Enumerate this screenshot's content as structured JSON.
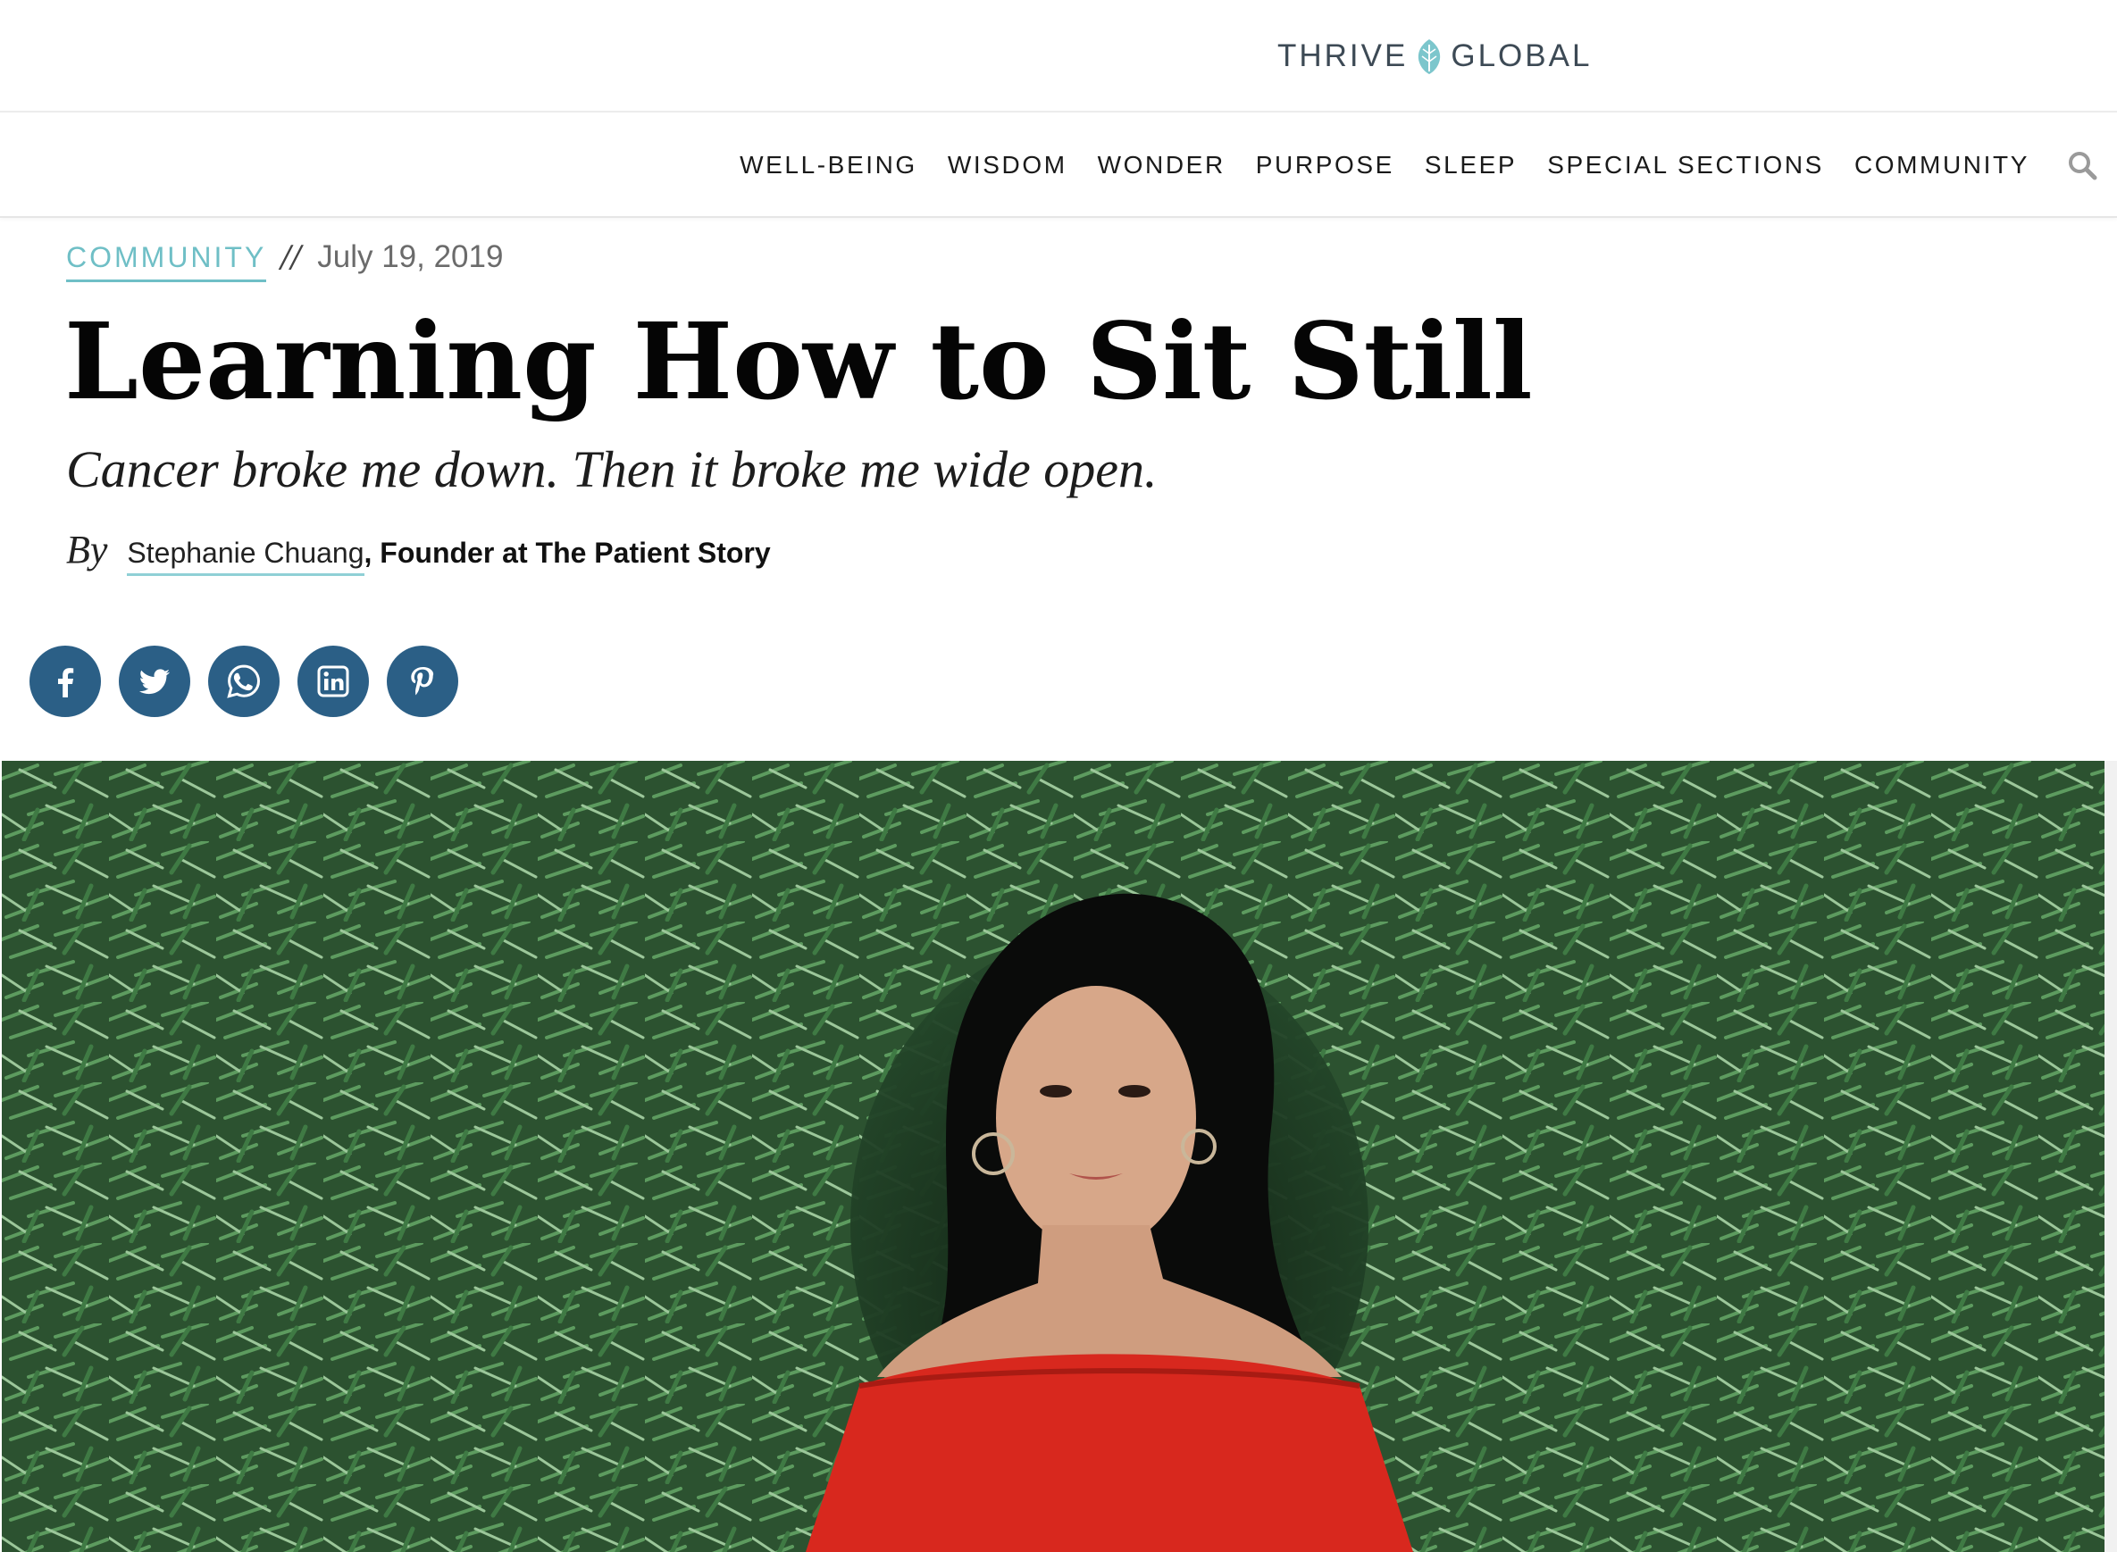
{
  "brand": {
    "name_left": "THRIVE",
    "name_right": "GLOBAL",
    "leaf_color": "#7cc6cc"
  },
  "nav": {
    "items": [
      {
        "label": "WELL-BEING"
      },
      {
        "label": "WISDOM"
      },
      {
        "label": "WONDER"
      },
      {
        "label": "PURPOSE"
      },
      {
        "label": "SLEEP"
      },
      {
        "label": "SPECIAL SECTIONS"
      },
      {
        "label": "COMMUNITY"
      }
    ],
    "search_icon": "search-icon"
  },
  "article": {
    "category": "COMMUNITY",
    "separator": "//",
    "date": "July 19, 2019",
    "title": "Learning How to Sit Still",
    "subtitle": "Cancer broke me down. Then it broke me wide open.",
    "by_label": "By",
    "author": "Stephanie Chuang",
    "author_role": ", Founder at The Patient Story"
  },
  "share": {
    "buttons": [
      {
        "icon": "facebook-icon"
      },
      {
        "icon": "twitter-icon"
      },
      {
        "icon": "whatsapp-icon"
      },
      {
        "icon": "linkedin-icon"
      },
      {
        "icon": "pinterest-icon"
      }
    ],
    "color": "#2b5f86"
  },
  "hero": {
    "foliage_color": "#2f5a32",
    "dress_color": "#d8281e"
  },
  "colors": {
    "accent": "#6fbfc6",
    "text": "#111111"
  }
}
